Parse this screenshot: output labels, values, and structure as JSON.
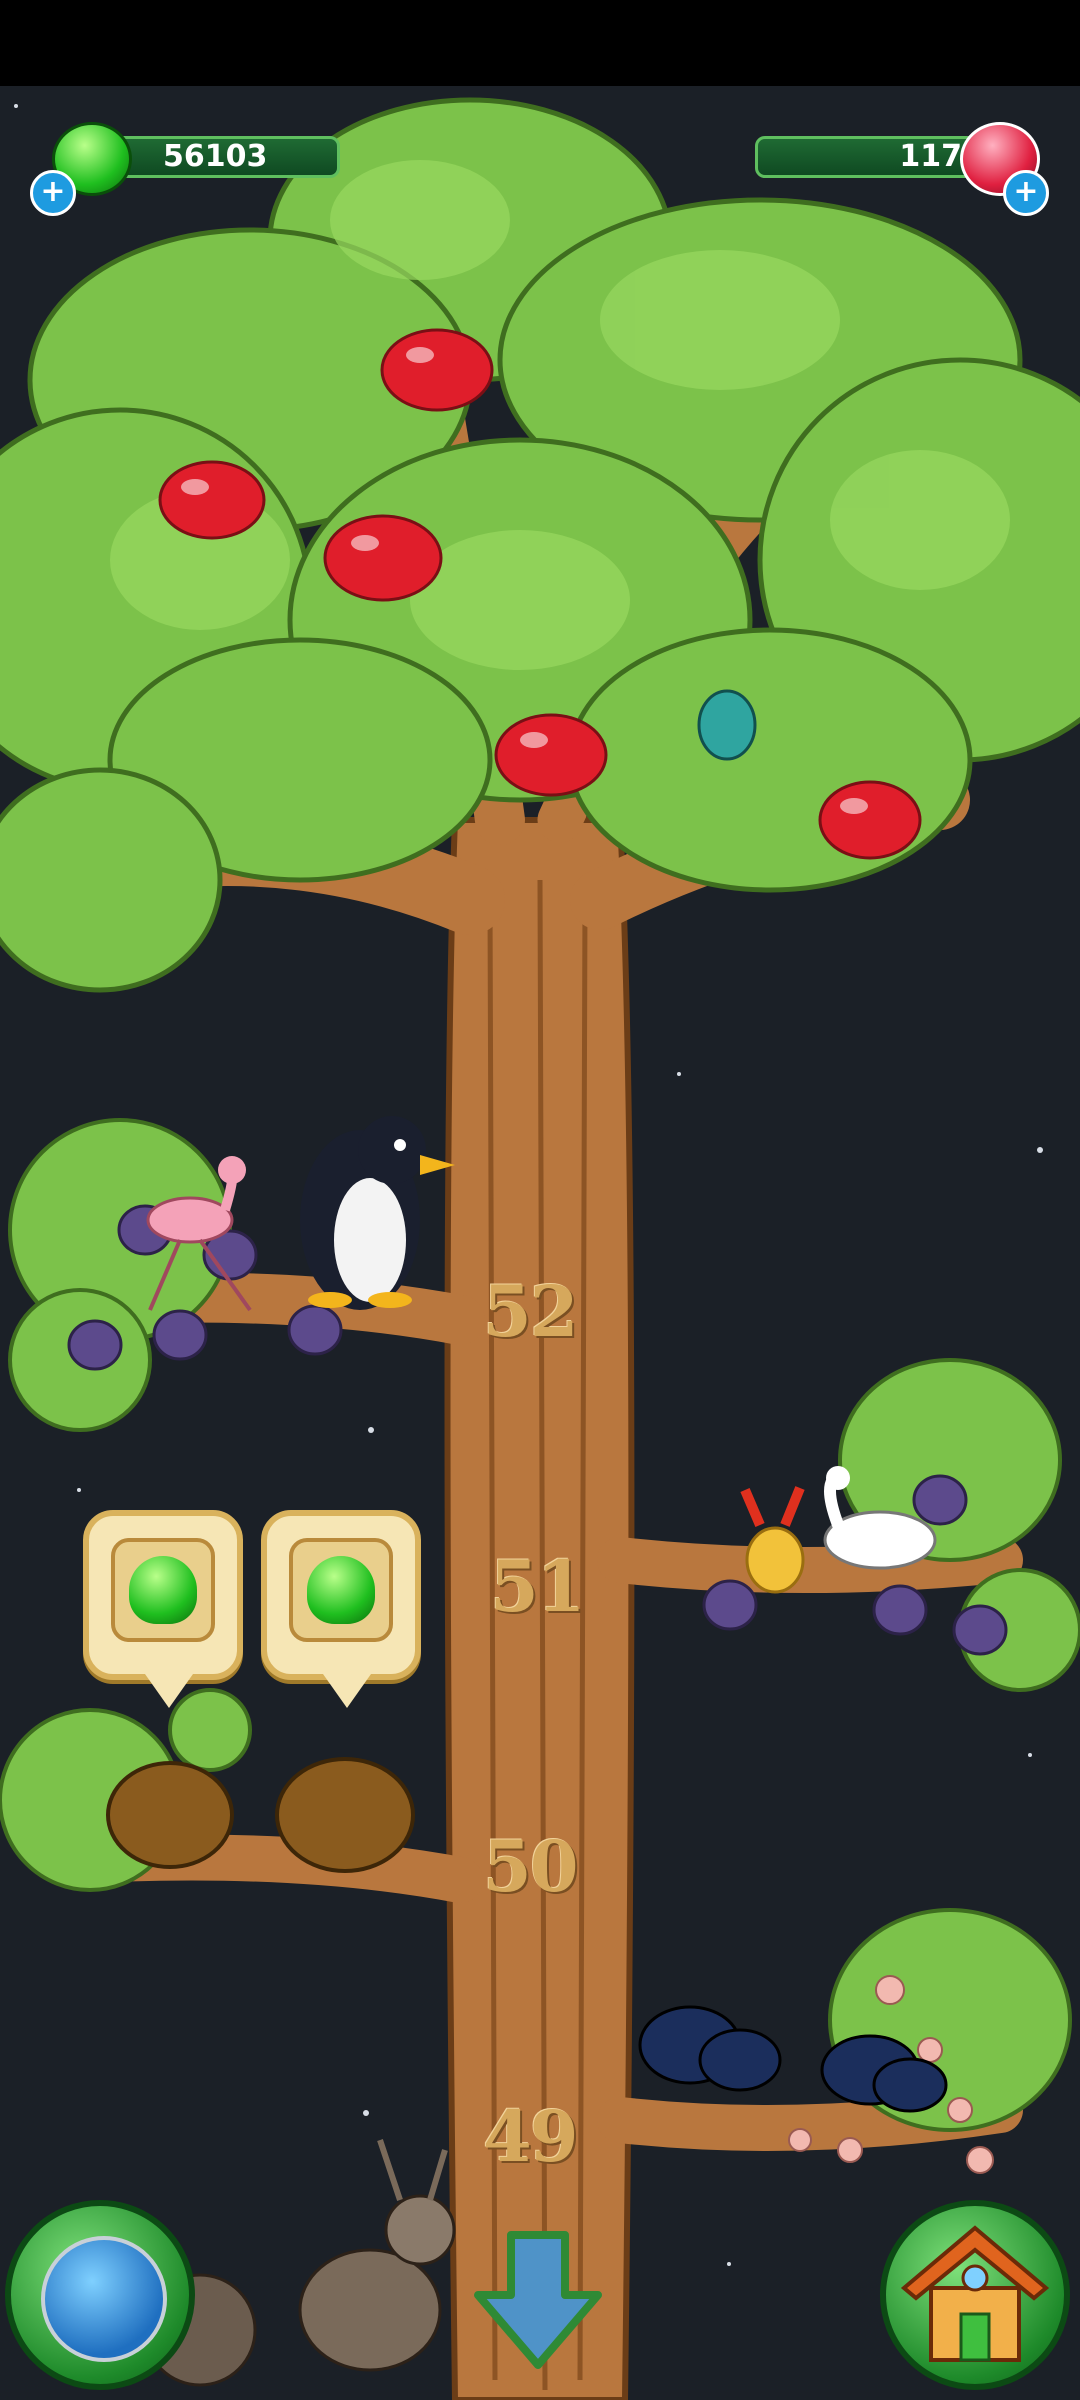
{
  "hud": {
    "gems_count": "56103",
    "crystals_count": "117",
    "add_gems_icon": "plus-icon",
    "add_crystals_icon": "plus-icon"
  },
  "tree": {
    "levels": [
      {
        "label": "52"
      },
      {
        "label": "51"
      },
      {
        "label": "50"
      },
      {
        "label": "49"
      }
    ]
  },
  "buttons": {
    "world_map_icon": "globe-icon",
    "scroll_down_icon": "arrow-down-icon",
    "home_icon": "house-icon"
  },
  "colors": {
    "leaf": "#7cc24a",
    "trunk": "#b9773e",
    "sky": "#1b2027",
    "fruit": "#e01e2b"
  }
}
